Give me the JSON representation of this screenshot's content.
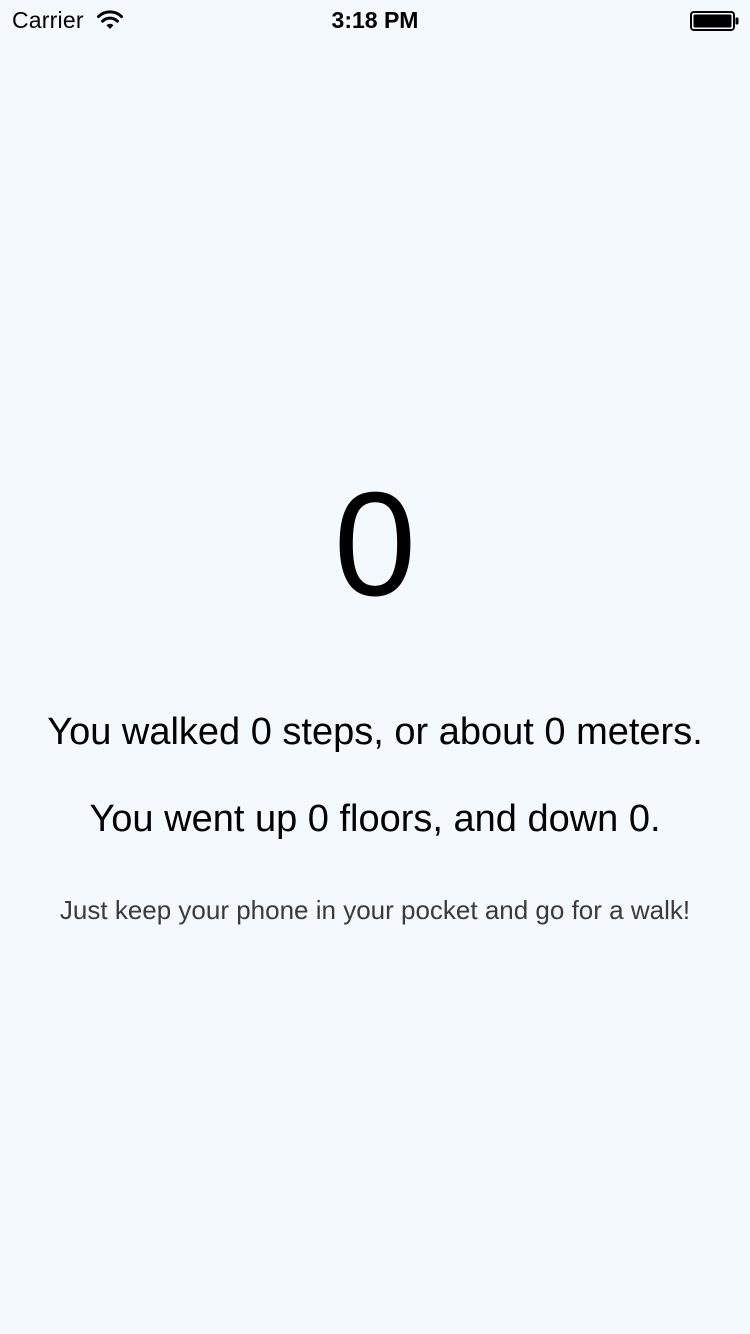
{
  "status_bar": {
    "carrier": "Carrier",
    "time": "3:18 PM",
    "icons": [
      "wifi-icon",
      "battery-icon"
    ]
  },
  "main": {
    "step_count": "0",
    "steps_text": "You walked 0 steps, or about 0 meters.",
    "floors_text": "You went up 0 floors, and down 0.",
    "hint_text": "Just keep your phone in your pocket and go for a walk!"
  },
  "colors": {
    "background": "#f4f9fd",
    "text": "#000000",
    "hint_text": "#3a3a3a"
  }
}
